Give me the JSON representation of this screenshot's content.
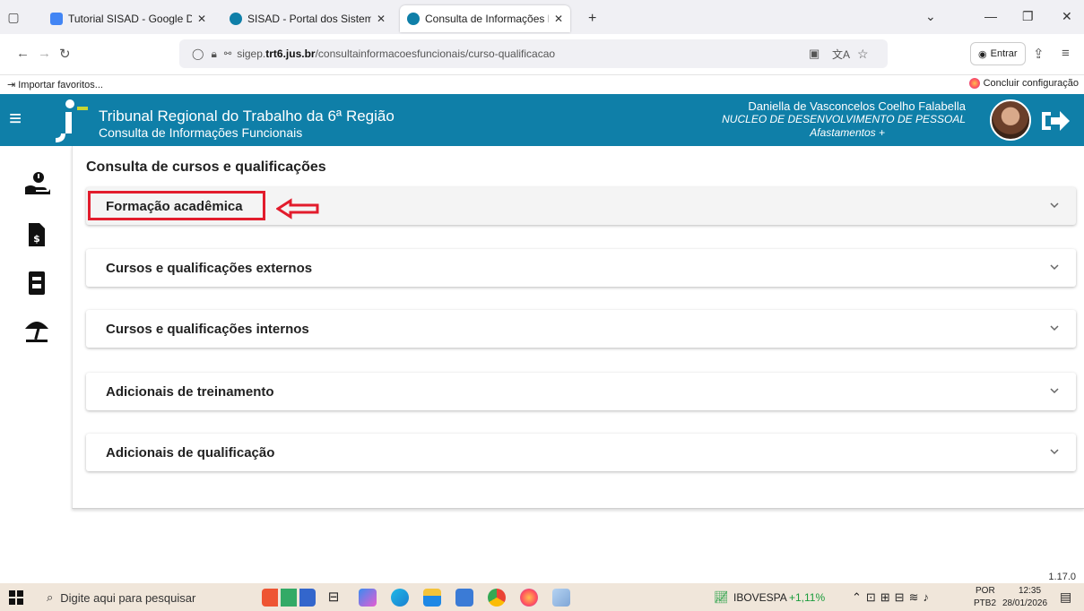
{
  "browser": {
    "tabs": [
      {
        "title": "Tutorial SISAD - Google Docs",
        "color": "#4285f4"
      },
      {
        "title": "SISAD - Portal dos Sistemas Adi",
        "color": "#0f7fa8"
      },
      {
        "title": "Consulta de Informações Funcio",
        "color": "#0f7fa8"
      }
    ],
    "url_prefix": "sigep.",
    "url_domain": "trt6.jus.br",
    "url_path": "/consultainformacoesfuncionais/curso-qualificacao",
    "signin_label": "Entrar",
    "bookmark_import": "Importar favoritos...",
    "bookmark_setup": "Concluir configuração"
  },
  "header": {
    "org_name": "Tribunal Regional do Trabalho da 6ª Região",
    "system_name": "Consulta de Informações Funcionais",
    "user_name": "Daniella de Vasconcelos Coelho Falabella",
    "user_unit": "NUCLEO DE DESENVOLVIMENTO DE PESSOAL",
    "user_status": "Afastamentos +"
  },
  "main": {
    "title": "Consulta de cursos e qualificações",
    "panels": [
      {
        "label": "Formação acadêmica"
      },
      {
        "label": "Cursos e qualificações externos"
      },
      {
        "label": "Cursos e qualificações internos"
      },
      {
        "label": "Adicionais de treinamento"
      },
      {
        "label": "Adicionais de qualificação"
      }
    ]
  },
  "footer": {
    "version": "1.17.0"
  },
  "taskbar": {
    "search_placeholder": "Digite aqui para pesquisar",
    "stock_name": "IBOVESPA",
    "stock_change": "+1,11%",
    "lang_top": "POR",
    "lang_bottom": "PTB2",
    "time": "12:35",
    "date": "28/01/2026"
  },
  "colors": {
    "header_bg": "#0f7fa8",
    "highlight": "#e21c2c",
    "stock_up": "#1a9c3c"
  }
}
